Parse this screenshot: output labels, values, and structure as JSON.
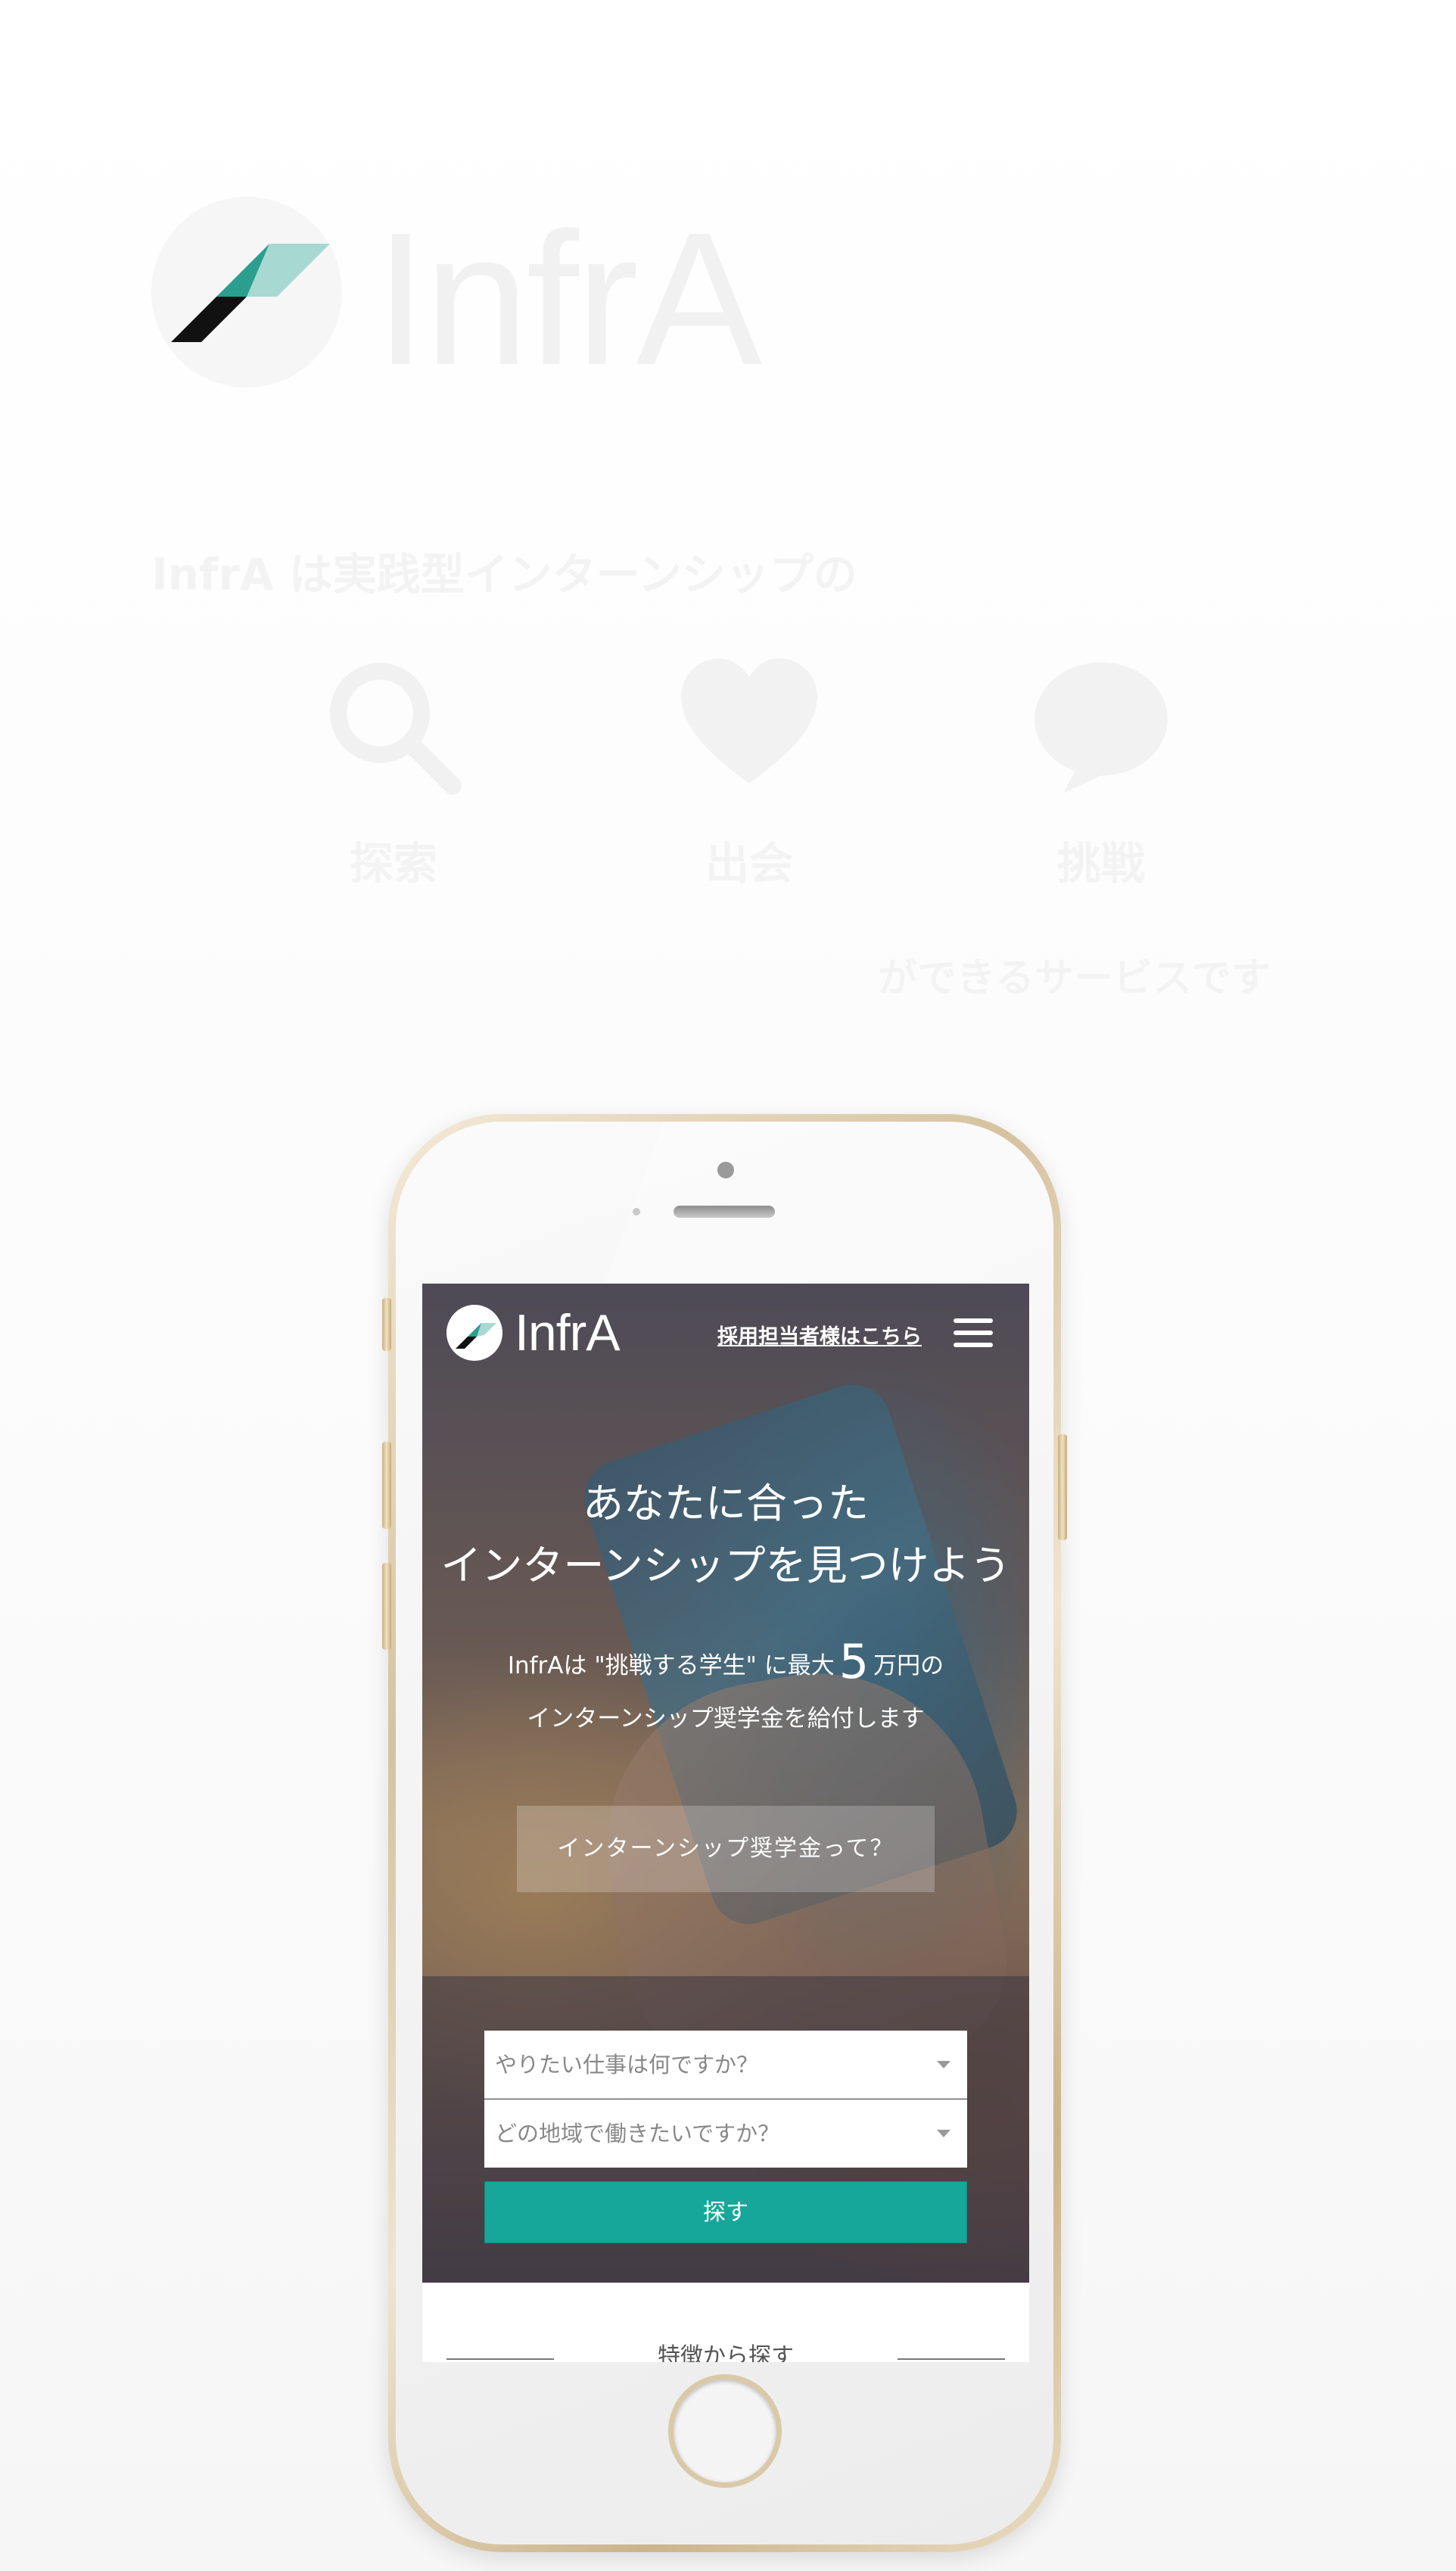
{
  "promo": {
    "logo_text": "InfrA",
    "tagline": "InfrA は実践型インターンシップの",
    "features": [
      {
        "icon": "search-icon",
        "label": "探索"
      },
      {
        "icon": "heart-icon",
        "label": "出会"
      },
      {
        "icon": "bulb-icon",
        "label": "挑戦"
      }
    ],
    "closing": "ができるサービスです"
  },
  "header": {
    "logo_text": "InfrA",
    "recruiter_link": "採用担当者様はこちら",
    "menu_icon": "hamburger-icon"
  },
  "hero": {
    "headline_1": "あなたに合った",
    "headline_2": "インターンシップを見つけよう",
    "sub_1a": "InfrAは \"挑戦する学生\" に最大",
    "sub_amount": "5",
    "sub_1b": "万円の",
    "sub_2": "インターンシップ奨学金を給付します",
    "scholarship_button": "インターンシップ奨学金って？"
  },
  "search": {
    "job_placeholder": "やりたい仕事は何ですか？",
    "area_placeholder": "どの地域で働きたいですか？",
    "button": "探す"
  },
  "features_section": {
    "title": "特徴から探す"
  },
  "colors": {
    "accent": "#17a79a",
    "logo_teal": "#1b8c7f",
    "logo_light": "#a8d8d2"
  }
}
